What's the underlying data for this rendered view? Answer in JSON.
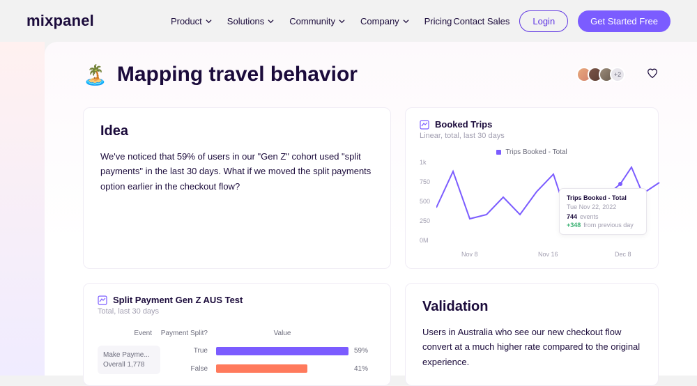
{
  "brand": "mixpanel",
  "nav": {
    "product": "Product",
    "solutions": "Solutions",
    "community": "Community",
    "company": "Company",
    "pricing": "Pricing"
  },
  "actions": {
    "contact": "Contact Sales",
    "login": "Login",
    "cta": "Get Started Free"
  },
  "page": {
    "emoji": "🏝️",
    "title": "Mapping travel behavior",
    "more": "+2"
  },
  "idea": {
    "heading": "Idea",
    "body": "We've noticed that 59% of users in our \"Gen Z\" cohort used \"split payments\" in the last 30 days. What if we moved the split payments option earlier in the checkout flow?"
  },
  "booked": {
    "title": "Booked Trips",
    "sub": "Linear, total, last 30 days",
    "legend": "Trips Booked - Total",
    "yticks": [
      "1k",
      "750",
      "500",
      "250",
      "0M"
    ],
    "xticks": [
      "Nov 8",
      "Nov 16",
      "Dec 8"
    ],
    "tooltip": {
      "title": "Trips Booked - Total",
      "date": "Tue Nov 22, 2022",
      "val": "744",
      "val_lbl": "events",
      "delta": "+348",
      "delta_lbl": "from previous day"
    }
  },
  "split": {
    "title": "Split Payment Gen Z AUS Test",
    "sub": "Total, last 30 days",
    "cols": {
      "event": "Event",
      "ps": "Payment Split?",
      "value": "Value"
    },
    "event": {
      "name": "Make Payme...",
      "overall": "Overall 1,778"
    },
    "rows": [
      {
        "label": "True",
        "pct": "59%"
      },
      {
        "label": "False",
        "pct": "41%"
      }
    ]
  },
  "validation": {
    "heading": "Validation",
    "body": "Users in Australia who see our new checkout flow convert at a much higher rate compared to the original experience."
  },
  "chart_data": {
    "type": "line",
    "title": "Booked Trips",
    "subtitle": "Linear, total, last 30 days",
    "series": [
      {
        "name": "Trips Booked - Total",
        "values": [
          400,
          850,
          300,
          350,
          550,
          350,
          620,
          820,
          250,
          280,
          580,
          744,
          900,
          650,
          780
        ]
      }
    ],
    "ylim": [
      0,
      1000
    ],
    "yticks": [
      0,
      250,
      500,
      750,
      1000
    ],
    "x_labels_visible": [
      "Nov 8",
      "Nov 16",
      "Dec 8"
    ],
    "tooltip": {
      "date": "Tue Nov 22, 2022",
      "value": 744,
      "delta": 348
    }
  }
}
